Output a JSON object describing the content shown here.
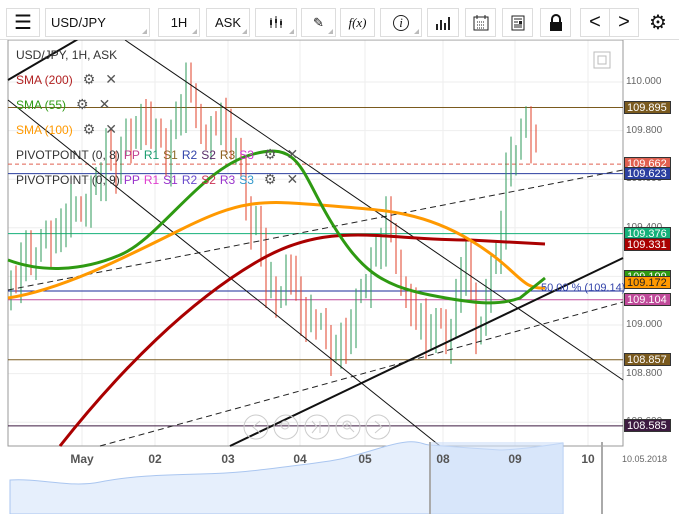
{
  "toolbar": {
    "menu_icon": "hamburger-icon",
    "symbol": "USD/JPY",
    "timeframe": "1H",
    "price_side": "ASK",
    "chart_type_icon": "candlestick-icon",
    "draw_icon": "pencil-icon",
    "indicator_label": "f(x)",
    "info_label": "i",
    "volume_icon": "bar-chart-icon",
    "calendar_icon": "calendar-icon",
    "report_icon": "report-icon",
    "lock_icon": "lock-icon",
    "prev_label": "<",
    "next_label": ">",
    "settings_icon": "gear-icon"
  },
  "legend": {
    "title": "USD/JPY, 1H, ASK",
    "sma200": {
      "label": "SMA (200)",
      "color": "#b22222"
    },
    "sma55": {
      "label": "SMA (55)",
      "color": "#2e9a12"
    },
    "sma100": {
      "label": "SMA (100)",
      "color": "#ff9900"
    },
    "pivot1": {
      "label": "PIVOTPOINT (0, 8)",
      "parts": [
        {
          "t": "PP",
          "c": "#c2408f"
        },
        {
          "t": "R1",
          "c": "#1a9c6e"
        },
        {
          "t": "S1",
          "c": "#8b6a2a"
        },
        {
          "t": "R2",
          "c": "#3344aa"
        },
        {
          "t": "S2",
          "c": "#5a2d6a"
        },
        {
          "t": "R3",
          "c": "#8b6020"
        },
        {
          "t": "S3",
          "c": "#cc33cc"
        }
      ]
    },
    "pivot2": {
      "label": "PIVOTPOINT (0, 9)",
      "parts": [
        {
          "t": "PP",
          "c": "#9933cc"
        },
        {
          "t": "R1",
          "c": "#e040d0"
        },
        {
          "t": "S1",
          "c": "#9933cc"
        },
        {
          "t": "R2",
          "c": "#6a4acc"
        },
        {
          "t": "S2",
          "c": "#cc3355"
        },
        {
          "t": "R3",
          "c": "#9933cc"
        },
        {
          "t": "S3",
          "c": "#3399cc"
        }
      ]
    }
  },
  "price_ticks": [
    "110.000",
    "109.800",
    "109.600",
    "109.400",
    "109.200",
    "109.000",
    "108.800",
    "108.600"
  ],
  "price_labels": [
    {
      "value": "109.895",
      "color": "#7a5a1e"
    },
    {
      "value": "109.662",
      "color": "#e06050"
    },
    {
      "value": "109.623",
      "color": "#2b3fa0"
    },
    {
      "value": "109.376",
      "color": "#15b07a"
    },
    {
      "value": "109.331",
      "color": "#aa0000"
    },
    {
      "value": "109.199",
      "color": "#2e9a12"
    },
    {
      "value": "109.172",
      "color": "#ff9900"
    },
    {
      "value": "109.104",
      "color": "#c04a9a"
    },
    {
      "value": "108.857",
      "color": "#7a5a1e"
    },
    {
      "value": "108.585",
      "color": "#3d1a40"
    }
  ],
  "fib_label": "50.00 % (109.14)",
  "x_labels": [
    "May",
    "02",
    "03",
    "04",
    "05",
    "08",
    "09",
    "10"
  ],
  "date_label": "10.05.2018",
  "nav_icons": [
    "arrow-left-icon",
    "zoom-out-icon",
    "skip-end-icon",
    "zoom-in-icon",
    "arrow-right-icon"
  ],
  "chart_data": {
    "type": "candlestick",
    "closes": [
      109.15,
      109.2,
      109.3,
      109.25,
      109.4,
      109.35,
      109.45,
      109.5,
      109.45,
      109.6,
      109.7,
      109.65,
      109.8,
      109.75,
      109.85,
      109.8,
      109.7,
      109.85,
      109.95,
      109.9,
      109.75,
      109.85,
      109.8,
      109.7,
      109.5,
      109.4,
      109.2,
      109.1,
      109.2,
      109.15,
      109.0,
      109.05,
      108.95,
      108.85,
      108.95,
      109.1,
      109.2,
      109.3,
      109.4,
      109.3,
      109.1,
      109.05,
      108.95,
      109.0,
      108.95,
      109.1,
      109.3,
      108.95,
      109.1,
      109.3,
      109.6,
      109.75,
      109.85,
      109.7
    ]
  }
}
